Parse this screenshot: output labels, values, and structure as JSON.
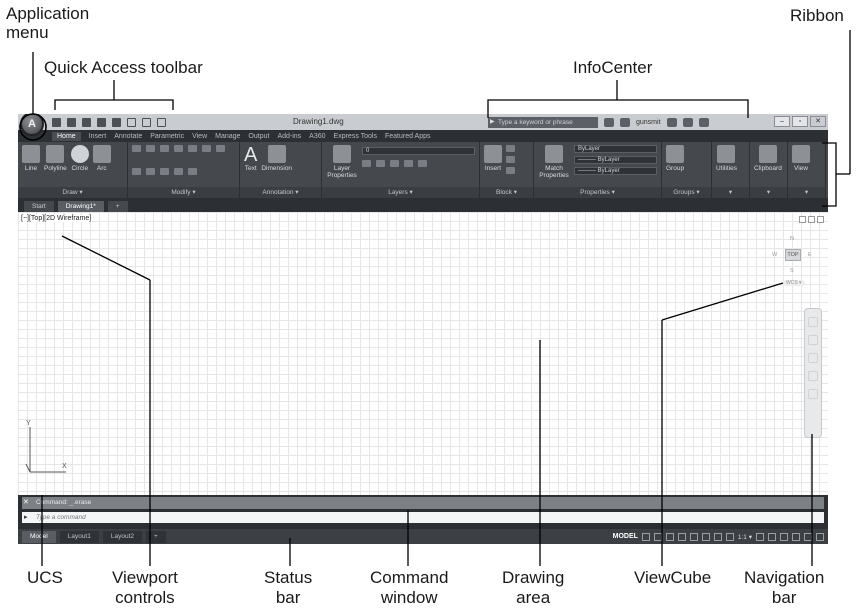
{
  "callouts": {
    "application_menu": "Application\nmenu",
    "quick_access_toolbar": "Quick Access toolbar",
    "infocenter": "InfoCenter",
    "ribbon": "Ribbon",
    "ucs": "UCS",
    "viewport_controls": "Viewport\ncontrols",
    "status_bar": "Status\nbar",
    "command_window": "Command\nwindow",
    "drawing_area": "Drawing\narea",
    "viewcube": "ViewCube",
    "navigation_bar": "Navigation\nbar"
  },
  "window": {
    "document_title": "Drawing1.dwg",
    "search_placeholder": "Type a keyword or phrase",
    "user": "gunsmit",
    "controls": [
      "–",
      "▫",
      "✕"
    ]
  },
  "ribbon_tabs": [
    "Home",
    "Insert",
    "Annotate",
    "Parametric",
    "View",
    "Manage",
    "Output",
    "Add-ins",
    "A360",
    "Express Tools",
    "Featured Apps"
  ],
  "ribbon_active_tab": "Home",
  "panels": {
    "draw": {
      "name": "Draw ▾",
      "tools": [
        "Line",
        "Polyline",
        "Circle",
        "Arc"
      ]
    },
    "modify": {
      "name": "Modify ▾"
    },
    "annotation": {
      "name": "Annotation ▾",
      "tools": [
        "Text",
        "Dimension"
      ]
    },
    "layers": {
      "name": "Layers ▾",
      "tools": [
        "Layer Properties"
      ],
      "current": "0"
    },
    "block": {
      "name": "Block ▾",
      "tools": [
        "Insert"
      ]
    },
    "properties": {
      "name": "Properties ▾",
      "tools": [
        "Match Properties"
      ],
      "dropdowns": [
        "ByLayer",
        "——— ByLayer",
        "——— ByLayer"
      ]
    },
    "groups": {
      "name": "Groups ▾",
      "tools": [
        "Group"
      ]
    },
    "utilities": {
      "tools": [
        "Utilities"
      ]
    },
    "clipboard": {
      "tools": [
        "Clipboard"
      ]
    },
    "view": {
      "tools": [
        "View"
      ]
    }
  },
  "document_tabs": [
    "Start",
    "Drawing1*"
  ],
  "viewport": {
    "controls_label": "[−][Top][2D Wireframe]",
    "viewcube_face": "TOP",
    "viewcube_dirs": {
      "n": "N",
      "s": "S",
      "e": "E",
      "w": "W"
    },
    "wcs_label": "WCS ▾"
  },
  "ucs": {
    "x_label": "X",
    "y_label": "Y"
  },
  "command": {
    "history": "Command:  _.erase",
    "close": "✕",
    "prompt_icon": "▸",
    "placeholder": "Type a command"
  },
  "layout_tabs": [
    "Model",
    "Layout1",
    "Layout2",
    "+"
  ],
  "status": {
    "model": "MODEL",
    "scale": "1:1 ▾"
  }
}
